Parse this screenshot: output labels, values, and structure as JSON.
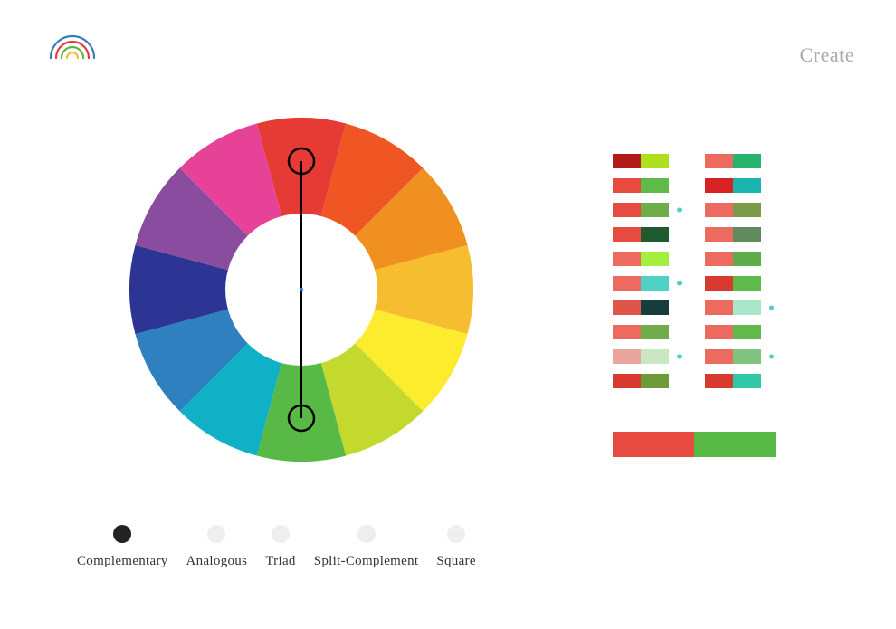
{
  "header": {
    "create_label": "Create"
  },
  "wheel": {
    "colors": [
      "#e63a34",
      "#f05624",
      "#ef9020",
      "#f6bd30",
      "#fdeb2e",
      "#c3d92e",
      "#58b947",
      "#10b0c7",
      "#2f80bf",
      "#2c3593",
      "#8a4c9e",
      "#e64297"
    ],
    "selection_angle_top": 0,
    "selection_angle_bottom": 180
  },
  "tabs": [
    {
      "label": "Complementary",
      "active": true
    },
    {
      "label": "Analogous",
      "active": false
    },
    {
      "label": "Triad",
      "active": false
    },
    {
      "label": "Split-Complement",
      "active": false
    },
    {
      "label": "Square",
      "active": false
    }
  ],
  "palettes_left": [
    {
      "a": "#b51a1a",
      "b": "#aee01e",
      "selected": false
    },
    {
      "a": "#e74a3f",
      "b": "#5fba4a",
      "selected": false
    },
    {
      "a": "#e74a3f",
      "b": "#6fad4a",
      "selected": true
    },
    {
      "a": "#e74a3f",
      "b": "#1e5b2e",
      "selected": false
    },
    {
      "a": "#ec6a5e",
      "b": "#a4ef3e",
      "selected": false
    },
    {
      "a": "#ec6a5e",
      "b": "#4fd1c5",
      "selected": true
    },
    {
      "a": "#df5548",
      "b": "#163c3b",
      "selected": false
    },
    {
      "a": "#ec6a5e",
      "b": "#6fad4a",
      "selected": false
    },
    {
      "a": "#eca59e",
      "b": "#c8e7c2",
      "selected": true
    },
    {
      "a": "#d83a30",
      "b": "#6f9a3a",
      "selected": false
    }
  ],
  "palettes_right": [
    {
      "a": "#ec6a5e",
      "b": "#27b36b",
      "selected": false
    },
    {
      "a": "#d62222",
      "b": "#19b6b0",
      "selected": false
    },
    {
      "a": "#ec6a5e",
      "b": "#7a9a4a",
      "selected": false
    },
    {
      "a": "#ec6a5e",
      "b": "#5e8a5e",
      "selected": false
    },
    {
      "a": "#ec6a5e",
      "b": "#5fad4a",
      "selected": false
    },
    {
      "a": "#d83a30",
      "b": "#5fba4a",
      "selected": false
    },
    {
      "a": "#ec6a5e",
      "b": "#a9e6ca",
      "selected": true
    },
    {
      "a": "#ec6a5e",
      "b": "#5fba4a",
      "selected": false
    },
    {
      "a": "#ec6a5e",
      "b": "#7fc47f",
      "selected": true
    },
    {
      "a": "#d83a30",
      "b": "#2fc9a6",
      "selected": false
    }
  ],
  "main_pair": {
    "a": "#e74a3f",
    "b": "#58b947"
  }
}
